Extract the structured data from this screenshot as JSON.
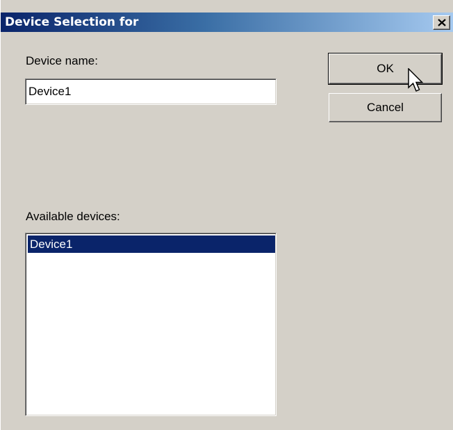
{
  "window": {
    "title": "Device Selection for",
    "close_icon": "close-icon"
  },
  "form": {
    "device_name_label": "Device name:",
    "device_name_value": "Device1",
    "available_devices_label": "Available devices:",
    "devices": [
      {
        "label": "Device1",
        "selected": true
      }
    ]
  },
  "buttons": {
    "ok_label": "OK",
    "cancel_label": "Cancel"
  },
  "colors": {
    "title_bar_start": "#0a246a",
    "title_bar_end": "#a6caf0",
    "dialog_face": "#d4d0c8",
    "selection": "#0a246a"
  },
  "icons": {
    "cursor": "mouse-pointer-icon"
  }
}
